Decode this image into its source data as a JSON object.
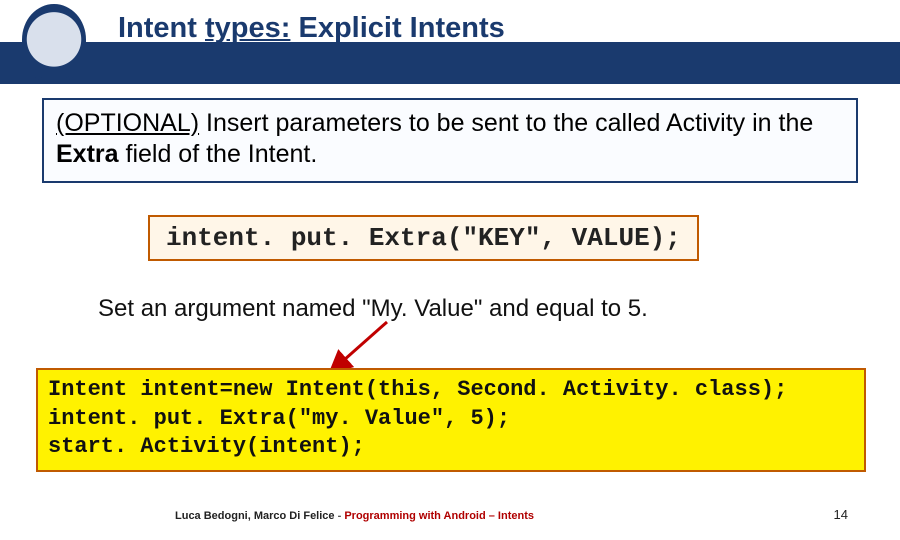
{
  "header": {
    "title_prefix": "Intent ",
    "title_underlined": "types:",
    "title_suffix": " Explicit Intents"
  },
  "box1": {
    "optional": "(OPTIONAL)",
    "text1": " Insert parameters to be sent to the called Activity in the ",
    "extra": "Extra",
    "text2": " field of the Intent."
  },
  "box2": {
    "code": "intent. put. Extra(\"KEY\", VALUE);"
  },
  "midtext": "Set an argument named \"My. Value\" and equal to 5.",
  "box3": {
    "line1": "Intent intent=new Intent(this, Second. Activity. class);",
    "line2": "intent. put. Extra(\"my. Value\", 5);",
    "line3": "start. Activity(intent);"
  },
  "footer": {
    "authors": "Luca Bedogni, Marco Di Felice ",
    "dash": "- ",
    "course": "Programming with Android – Intents",
    "pagenum": "14"
  }
}
